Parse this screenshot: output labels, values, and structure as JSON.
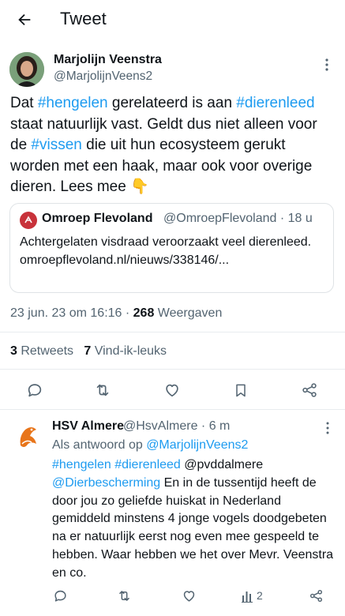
{
  "header": {
    "title": "Tweet"
  },
  "tweet": {
    "author_name": "Marjolijn Veenstra",
    "author_handle": "@MarjolijnVeens2",
    "text_parts": {
      "p1": "Dat ",
      "tag1": "#hengelen",
      "p2": " gerelateerd is aan ",
      "tag2": "#dierenleed",
      "p3": " staat natuurlijk vast. Geldt dus niet alleen voor de ",
      "tag3": "#vissen",
      "p4": " die uit hun ecosysteem gerukt worden met een haak, maar ook voor overige dieren. Lees mee ",
      "emoji": "👇"
    },
    "quote": {
      "name": "Omroep Flevoland",
      "handle_time": "@OmroepFlevoland · 18 u",
      "text": "Achtergelaten visdraad veroorzaakt veel dierenleed. omroepflevoland.nl/nieuws/338146/..."
    },
    "date": "23 jun. 23 om 16:16",
    "separator": " · ",
    "views_count": "268",
    "views_label": " Weergaven",
    "retweets_count": "3",
    "retweets_label": " Retweets",
    "likes_count": "7",
    "likes_label": " Vind-ik-leuks"
  },
  "reply": {
    "author_name": "HSV Almere",
    "handle_time": "@HsvAlmere · 6 m",
    "reply_to_label": "Als antwoord op ",
    "reply_to_handle": "@MarjolijnVeens2",
    "text_parts": {
      "tag1": "#hengelen",
      "sp1": " ",
      "tag2": "#dierenleed",
      "p1": " @pvddalmere ",
      "tag3": "@Dierbescherming",
      "p2": " En in de tussentijd heeft de door jou zo geliefde huiskat in Nederland gemiddeld minstens 4 jonge vogels doodgebeten na er natuurlijk eerst nog even mee gespeeld te hebben. Waar hebben we het over Mevr. Veenstra en co."
    },
    "views_count": "2"
  },
  "colors": {
    "accent": "#1d9bf0",
    "text": "#0f1419",
    "secondary": "#536471",
    "quote_icon": "#c8323a",
    "hsv_logo": "#e8751a"
  }
}
